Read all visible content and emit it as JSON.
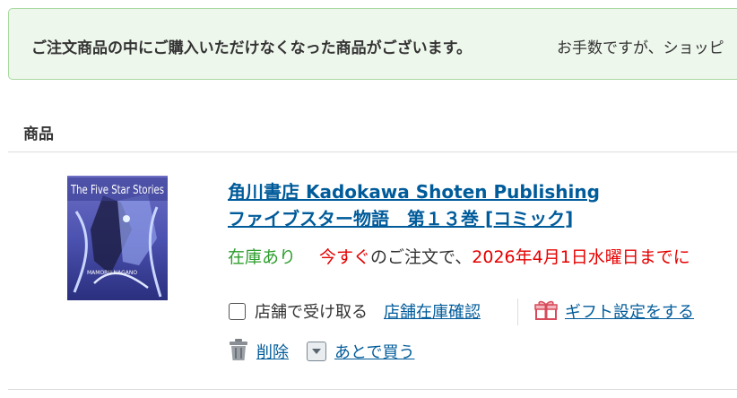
{
  "notice": {
    "bold_text": "ご注文商品の中にご購入いただけなくなった商品がございます。",
    "rest_text": "お手数ですが、ショッピ"
  },
  "table": {
    "column_header": "商品"
  },
  "product": {
    "cover_title_art": "The Five Star Stories",
    "cover_author_art": "MAMORU NAGANO",
    "publisher_line": "角川書店 Kadokawa Shoten Publishing",
    "title_line": "ファイブスター物語　第１３巻 [コミック]",
    "stock_status": "在庫あり",
    "delivery_prefix": "今すぐ",
    "delivery_middle": "のご注文で、",
    "delivery_date": "2026年4月1日水曜日までに",
    "pickup_label": "店舗で受け取る",
    "store_stock_link": "店舗在庫確認",
    "gift_link": "ギフト設定をする",
    "delete_link": "削除",
    "save_later_link": "あとで買う"
  },
  "colors": {
    "link": "#005b9a",
    "in_stock": "#2e9e2e",
    "delivery_highlight": "#e60000",
    "notice_bg": "#eef7ec",
    "notice_border": "#a9d8a0"
  },
  "icons": [
    "checkbox-icon",
    "gift-icon",
    "trash-icon",
    "save-later-icon"
  ]
}
